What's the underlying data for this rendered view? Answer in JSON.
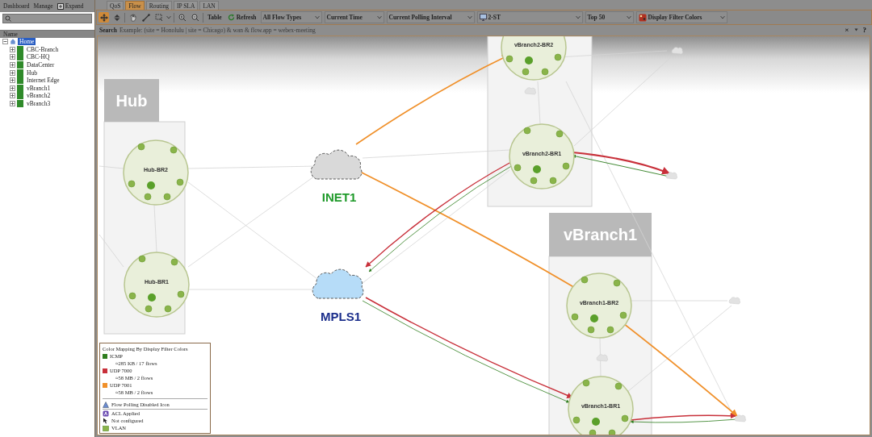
{
  "sidebar": {
    "toolbar": [
      "Dashboard",
      "Manage",
      "Expand"
    ],
    "tree": {
      "header": "Name",
      "items": [
        {
          "label": "Home",
          "selected": true,
          "expanded": true,
          "children": [
            {
              "label": "CBC-Branch",
              "selected": false,
              "expanded": false
            },
            {
              "label": "CBC-HQ",
              "selected": false,
              "expanded": false
            },
            {
              "label": "DataCenter",
              "selected": false,
              "expanded": false
            },
            {
              "label": "Hub",
              "selected": false,
              "expanded": false
            },
            {
              "label": "Internet Edge",
              "selected": false,
              "expanded": false
            },
            {
              "label": "vBranch1",
              "selected": false,
              "expanded": false
            },
            {
              "label": "vBranch2",
              "selected": false,
              "expanded": false
            },
            {
              "label": "vBranch3",
              "selected": false,
              "expanded": false
            }
          ]
        }
      ]
    }
  },
  "tabs": [
    {
      "label": "QoS",
      "selected": false
    },
    {
      "label": "Flow",
      "selected": true
    },
    {
      "label": "Routing",
      "selected": false
    },
    {
      "label": "IP SLA",
      "selected": false
    },
    {
      "label": "LAN",
      "selected": false
    }
  ],
  "toolbar": {
    "tools": [
      {
        "kind": "move",
        "selected": true
      },
      {
        "kind": "fit",
        "selected": false
      },
      {
        "kind": "hand",
        "selected": false
      },
      {
        "kind": "connect",
        "selected": false
      },
      {
        "kind": "select",
        "selected": false
      },
      {
        "kind": "zoom-in",
        "selected": false
      },
      {
        "kind": "zoom-out",
        "selected": false
      }
    ],
    "buttons": [
      {
        "label": "Table",
        "kind": "text"
      },
      {
        "label": "Refresh",
        "kind": "refresh"
      }
    ],
    "dropdowns": [
      "All Flow Types",
      "Current Time",
      "Current Polling Interval",
      "2-ST",
      "Top 50",
      "Display Filter Colors"
    ]
  },
  "search_bar": {
    "label": "Search",
    "placeholder": "Example: (site = Honolulu | site = Chicago) & wan & flow.app = webex-meeting",
    "close": "×",
    "help": "?"
  },
  "map": {
    "groups": [
      "Hub",
      "vBranch1"
    ],
    "routers": [
      {
        "name": "Hub-BR2"
      },
      {
        "name": "Hub-BR1"
      },
      {
        "name": "vBranch2-BR2"
      },
      {
        "name": "vBranch2-BR1"
      },
      {
        "name": "vBranch1-BR2"
      },
      {
        "name": "vBranch1-BR1"
      }
    ],
    "clouds": [
      {
        "name": "INET1",
        "color": "#1f9a2a",
        "highlighted": false
      },
      {
        "name": "MPLS1",
        "color": "#1c2f8c",
        "highlighted": true
      }
    ]
  },
  "legend": {
    "title": "Color Mapping By Display Filter Colors",
    "entries": [
      {
        "label": "ICMP",
        "color": "#2e7d1e",
        "detail": "≈285 KB / 17 flows"
      },
      {
        "label": "UDP 7000",
        "color": "#c8303a",
        "detail": "≈58 MB / 2 flows"
      },
      {
        "label": "UDP 7001",
        "color": "#f0902a",
        "detail": "≈58 MB / 2 flows"
      }
    ],
    "icons": [
      {
        "kind": "polling-disabled",
        "label": "Flow Polling Disabled Icon"
      },
      {
        "kind": "acl",
        "label": "ACL Applied"
      },
      {
        "kind": "not-configured",
        "label": "Not configured"
      },
      {
        "kind": "vlan",
        "label": "VLAN"
      }
    ]
  }
}
